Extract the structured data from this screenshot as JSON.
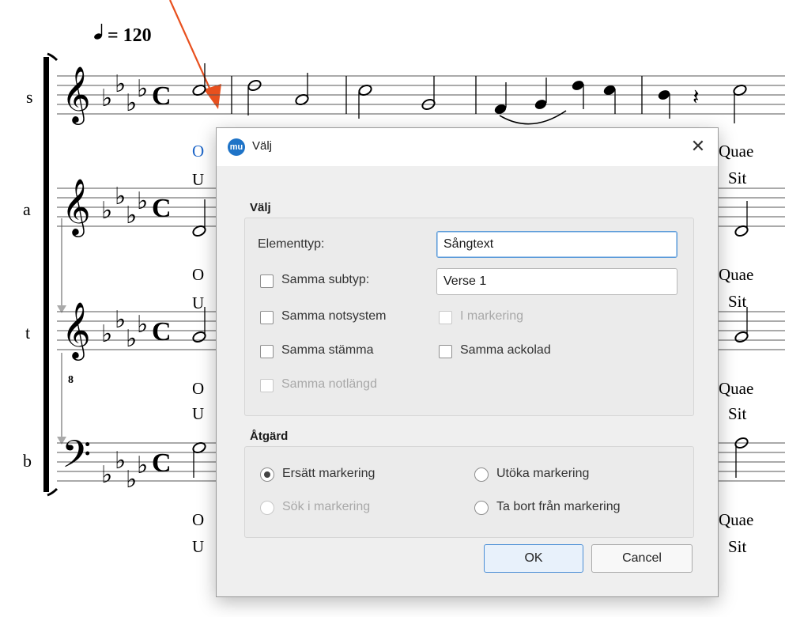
{
  "score": {
    "tempo": "= 120",
    "staff_labels": [
      "s",
      "a",
      "t",
      "b"
    ],
    "lyrics": {
      "alto_verse1": "O",
      "alto_verse2": "U",
      "right_verse1": "Quae",
      "right_verse2": "Sit"
    },
    "colors": {
      "annotation_arrow": "#e8501e",
      "lyric_selected": "#1e66c8"
    }
  },
  "dialog": {
    "title": "Välj",
    "app_icon": "musescore-icon",
    "close_glyph": "✕",
    "select_group": {
      "label": "Välj",
      "element_type_label": "Elementtyp:",
      "element_type_value": "Sångtext",
      "same_subtype_label": "Samma subtyp:",
      "same_subtype_value": "Verse 1",
      "same_staff_label": "Samma notsystem",
      "in_selection_label": "I markering",
      "same_voice_label": "Samma stämma",
      "same_system_label": "Samma ackolad",
      "same_duration_label": "Samma notlängd"
    },
    "action_group": {
      "label": "Åtgärd",
      "replace_label": "Ersätt markering",
      "add_label": "Utöka markering",
      "search_label": "Sök i markering",
      "remove_label": "Ta bort från markering",
      "selected": "replace"
    },
    "ok_label": "OK",
    "cancel_label": "Cancel"
  }
}
